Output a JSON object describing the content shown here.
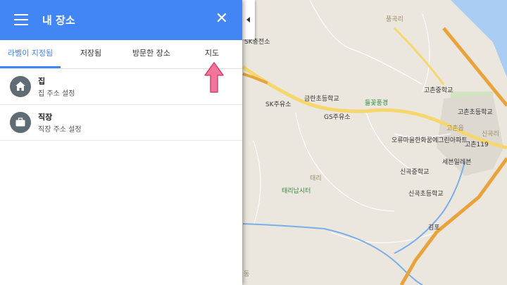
{
  "header": {
    "title": "내 장소"
  },
  "tabs": [
    {
      "label": "라벨이 지정됨",
      "active": true
    },
    {
      "label": "저장됨",
      "active": false
    },
    {
      "label": "방문한 장소",
      "active": false
    },
    {
      "label": "지도",
      "active": false
    }
  ],
  "places": [
    {
      "name": "집",
      "subtitle": "집 주소 설정",
      "icon": "home-icon"
    },
    {
      "name": "직장",
      "subtitle": "직장 주소 설정",
      "icon": "briefcase-icon"
    }
  ],
  "map_labels": {
    "l0": "풍곡리",
    "l1": "SK충전소",
    "l2": "금란초등학교",
    "l3": "SK주유소",
    "l4": "GS주유소",
    "l5": "들꽃풍경",
    "l6": "고촌중학교",
    "l7": "고촌초등학교",
    "l8": "고촌읍",
    "l9": "신곡리",
    "l10": "오류마을한화꿈에그린아파트",
    "l11": "고촌119",
    "l12": "세븐일레븐",
    "l13": "신곡중학교",
    "l14": "태리",
    "l15": "태리납시터",
    "l16": "신곡초등학교",
    "l17": "김포",
    "l18": "동"
  },
  "colors": {
    "header": "#4285f4",
    "active_tab": "#4285f4",
    "arrow": "#f4759b"
  }
}
